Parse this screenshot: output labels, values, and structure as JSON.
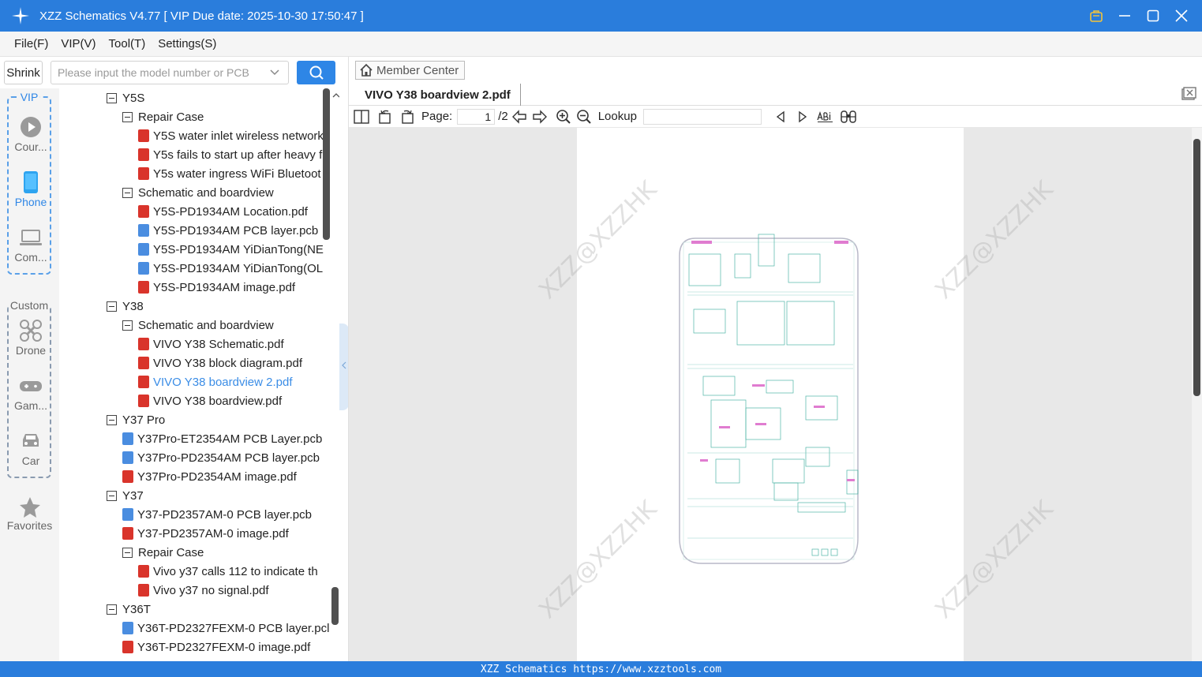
{
  "window": {
    "title": "XZZ Schematics V4.77 [ VIP Due date: 2025-10-30 17:50:47 ]"
  },
  "menu": [
    "File(F)",
    "VIP(V)",
    "Tool(T)",
    "Settings(S)"
  ],
  "left_toolbar": {
    "shrink_label": "Shrink",
    "search_placeholder": "Please input the model number or PCB"
  },
  "categories": {
    "vip_label": "VIP",
    "vip_items": [
      "Cour...",
      "Phone",
      "Com..."
    ],
    "custom_label": "Custom",
    "custom_items": [
      "Drone",
      "Gam...",
      "Car"
    ],
    "favorites_label": "Favorites"
  },
  "tree": [
    {
      "level": 0,
      "type": "folder",
      "label": "Y5S"
    },
    {
      "level": 1,
      "type": "folder",
      "label": "Repair Case"
    },
    {
      "level": 2,
      "type": "pdf",
      "label": "Y5S water inlet wireless network"
    },
    {
      "level": 2,
      "type": "pdf",
      "label": "Y5s fails to start up after heavy f"
    },
    {
      "level": 2,
      "type": "pdf",
      "label": "Y5s water ingress WiFi Bluetoot"
    },
    {
      "level": 1,
      "type": "folder",
      "label": "Schematic and boardview"
    },
    {
      "level": 2,
      "type": "pdf",
      "label": "Y5S-PD1934AM Location.pdf"
    },
    {
      "level": 2,
      "type": "pcb",
      "label": "Y5S-PD1934AM PCB layer.pcb"
    },
    {
      "level": 2,
      "type": "pcb",
      "label": "Y5S-PD1934AM YiDianTong(NE"
    },
    {
      "level": 2,
      "type": "pcb",
      "label": "Y5S-PD1934AM YiDianTong(OL"
    },
    {
      "level": 2,
      "type": "pdf",
      "label": "Y5S-PD1934AM image.pdf"
    },
    {
      "level": 0,
      "type": "folder",
      "label": "Y38"
    },
    {
      "level": 1,
      "type": "folder",
      "label": "Schematic and boardview"
    },
    {
      "level": 2,
      "type": "pdf",
      "label": "VIVO Y38 Schematic.pdf"
    },
    {
      "level": 2,
      "type": "pdf",
      "label": "VIVO Y38 block diagram.pdf"
    },
    {
      "level": 2,
      "type": "pdf",
      "label": "VIVO Y38 boardview 2.pdf",
      "selected": true
    },
    {
      "level": 2,
      "type": "pdf",
      "label": "VIVO Y38 boardview.pdf"
    },
    {
      "level": 0,
      "type": "folder",
      "label": "Y37 Pro"
    },
    {
      "level": 1,
      "type": "pcb",
      "label": "Y37Pro-ET2354AM PCB Layer.pcb"
    },
    {
      "level": 1,
      "type": "pcb",
      "label": "Y37Pro-PD2354AM PCB layer.pcb"
    },
    {
      "level": 1,
      "type": "pdf",
      "label": "Y37Pro-PD2354AM image.pdf"
    },
    {
      "level": 0,
      "type": "folder",
      "label": "Y37"
    },
    {
      "level": 1,
      "type": "pcb",
      "label": "Y37-PD2357AM-0 PCB layer.pcb"
    },
    {
      "level": 1,
      "type": "pdf",
      "label": "Y37-PD2357AM-0 image.pdf"
    },
    {
      "level": 1,
      "type": "folder",
      "label": "Repair Case"
    },
    {
      "level": 2,
      "type": "pdf",
      "label": "Vivo y37 calls 112 to indicate th"
    },
    {
      "level": 2,
      "type": "pdf",
      "label": "Vivo y37 no signal.pdf"
    },
    {
      "level": 0,
      "type": "folder",
      "label": "Y36T"
    },
    {
      "level": 1,
      "type": "pcb",
      "label": "Y36T-PD2327FEXM-0 PCB layer.pcl"
    },
    {
      "level": 1,
      "type": "pdf",
      "label": "Y36T-PD2327FEXM-0 image.pdf"
    }
  ],
  "right": {
    "member_center": "Member Center",
    "tab_title": "VIVO Y38 boardview 2.pdf",
    "page_label": "Page:",
    "page_current": "1",
    "page_total": "/2",
    "lookup_label": "Lookup",
    "watermark": "XZZ@XZZHK"
  },
  "status": "XZZ Schematics https://www.xzztools.com",
  "colors": {
    "titlebar": "#2a7ddc",
    "accent": "#2e86e6",
    "pdf_icon": "#d9342b",
    "pcb_icon": "#4a8de0"
  }
}
